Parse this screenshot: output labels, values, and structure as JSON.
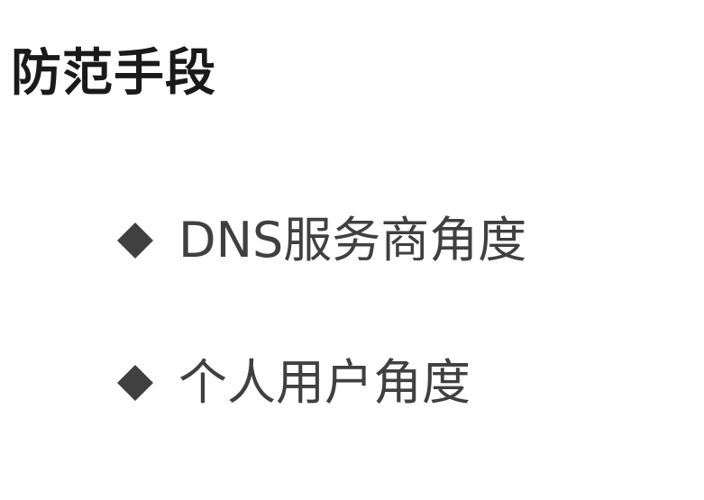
{
  "slide": {
    "title": "防范手段",
    "bullets": [
      {
        "icon": "diamond-bullet-icon",
        "text": "DNS服务商角度"
      },
      {
        "icon": "diamond-bullet-icon",
        "text": "个人用户角度"
      }
    ]
  },
  "colors": {
    "title": "#1a1a1a",
    "bullet_text": "#404040",
    "bullet_marker": "#404040",
    "background": "#ffffff"
  }
}
